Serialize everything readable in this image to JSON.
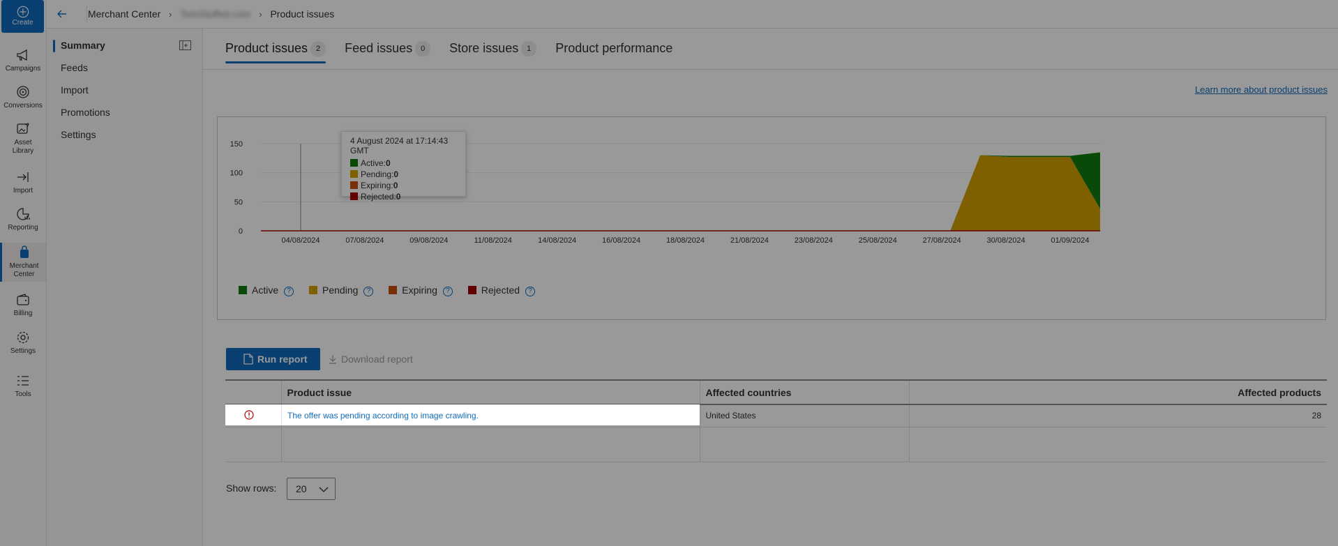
{
  "rail": {
    "create": "Create",
    "items": [
      "Campaigns",
      "Conversions",
      "Asset Library",
      "Import",
      "Reporting",
      "Merchant Center",
      "Billing",
      "Settings",
      "Tools"
    ],
    "asset_line1": "Asset",
    "asset_line2": "Library",
    "merchant_line1": "Merchant",
    "merchant_line2": "Center"
  },
  "topbar": {
    "crumb1": "Merchant Center",
    "crumb2": "TomStuffed.com",
    "crumb3": "Product issues"
  },
  "nav": {
    "items": [
      "Summary",
      "Feeds",
      "Import",
      "Promotions",
      "Settings"
    ]
  },
  "tabs": [
    {
      "label": "Product issues",
      "count": "2"
    },
    {
      "label": "Feed issues",
      "count": "0"
    },
    {
      "label": "Store issues",
      "count": "1"
    },
    {
      "label": "Product performance",
      "count": ""
    }
  ],
  "learn_link": "Learn more about product issues",
  "tooltip": {
    "title": "4 August 2024 at 17:14:43 GMT",
    "rows": [
      {
        "label": "Active:",
        "value": "0"
      },
      {
        "label": "Pending:",
        "value": "0"
      },
      {
        "label": "Expiring:",
        "value": "0"
      },
      {
        "label": "Rejected:",
        "value": "0"
      }
    ]
  },
  "chart_data": {
    "type": "area",
    "title": "",
    "xlabel": "",
    "ylabel": "",
    "ylim": [
      0,
      150
    ],
    "yticks": [
      0,
      50,
      100,
      150
    ],
    "x_tick_labels": [
      "04/08/2024",
      "07/08/2024",
      "09/08/2024",
      "11/08/2024",
      "14/08/2024",
      "16/08/2024",
      "18/08/2024",
      "21/08/2024",
      "23/08/2024",
      "25/08/2024",
      "27/08/2024",
      "30/08/2024",
      "01/09/2024"
    ],
    "x": [
      "04/08/2024",
      "27/08/2024",
      "28/08/2024",
      "29/08/2024",
      "30/08/2024",
      "31/08/2024",
      "01/09/2024"
    ],
    "series": [
      {
        "name": "Active",
        "values": [
          0,
          0,
          0,
          2,
          2,
          2,
          97
        ]
      },
      {
        "name": "Pending",
        "values": [
          0,
          0,
          130,
          127,
          127,
          127,
          38
        ]
      },
      {
        "name": "Expiring",
        "values": [
          0,
          0,
          0,
          0,
          0,
          0,
          0
        ]
      },
      {
        "name": "Rejected",
        "values": [
          0,
          0,
          0,
          0,
          0,
          0,
          0
        ]
      }
    ],
    "colors": {
      "Active": "#107c10",
      "Pending": "#d4a000",
      "Expiring": "#ca5010",
      "Rejected": "#a80000"
    },
    "legend_position": "bottom-left",
    "grid": true
  },
  "legend": [
    "Active",
    "Pending",
    "Expiring",
    "Rejected"
  ],
  "actions": {
    "run_report": "Run report",
    "download_report": "Download report"
  },
  "table": {
    "headers": [
      "Product issue",
      "Affected countries",
      "Affected products"
    ],
    "rows": [
      {
        "issue": "The offer was pending according to image crawling.",
        "countries": "United States",
        "products": "28"
      }
    ]
  },
  "show_rows": {
    "label": "Show rows:",
    "value": "20"
  },
  "colors": {
    "accent": "#0f6cbd"
  }
}
